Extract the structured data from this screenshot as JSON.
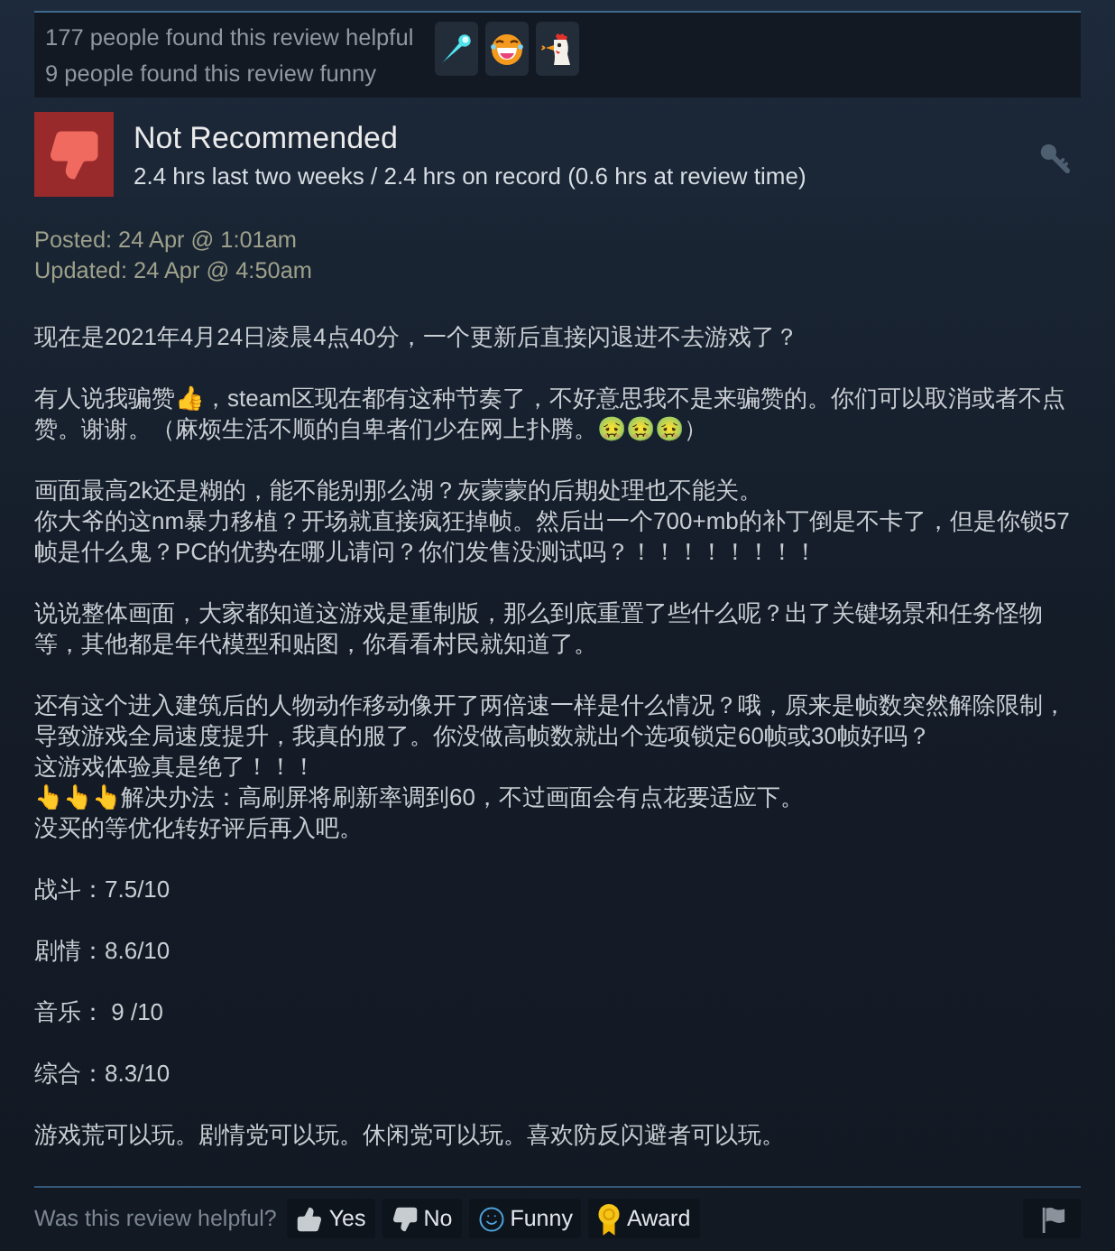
{
  "awards_summary": {
    "helpful_text": "177 people found this review helpful",
    "funny_text": "9 people found this review funny",
    "awards": [
      {
        "kind": "comet"
      },
      {
        "kind": "laughing-face"
      },
      {
        "kind": "rooster"
      }
    ]
  },
  "review_header": {
    "recommended": false,
    "verdict": "Not Recommended",
    "hours": "2.4 hrs last two weeks / 2.4 hrs on record (0.6 hrs at review time)"
  },
  "dates": {
    "posted": "Posted: 24 Apr @ 1:01am",
    "updated": "Updated: 24 Apr @ 4:50am"
  },
  "paragraphs": [
    {
      "lines": [
        "现在是2021年4月24日凌晨4点40分，一个更新后直接闪退进不去游戏了？"
      ]
    },
    {
      "lines": [
        "有人说我骗赞👍，steam区现在都有这种节奏了，不好意思我不是来骗赞的。你们可以取消或者不点赞。谢谢。（麻烦生活不顺的自卑者们少在网上扑腾。🤢🤢🤢）"
      ]
    },
    {
      "lines": [
        "画面最高2k还是糊的，能不能别那么湖？灰蒙蒙的后期处理也不能关。",
        "你大爷的这nm暴力移植？开场就直接疯狂掉帧。然后出一个700+mb的补丁倒是不卡了，但是你锁57帧是什么鬼？PC的优势在哪儿请问？你们发售没测试吗？！！！！！！！！"
      ]
    },
    {
      "lines": [
        "说说整体画面，大家都知道这游戏是重制版，那么到底重置了些什么呢？出了关键场景和任务怪物等，其他都是年代模型和贴图，你看看村民就知道了。"
      ]
    },
    {
      "lines": [
        "还有这个进入建筑后的人物动作移动像开了两倍速一样是什么情况？哦，原来是帧数突然解除限制，导致游戏全局速度提升，我真的服了。你没做高帧数就出个选项锁定60帧或30帧好吗？",
        "这游戏体验真是绝了！！！",
        "👆👆👆解决办法：高刷屏将刷新率调到60，不过画面会有点花要适应下。",
        "没买的等优化转好评后再入吧。"
      ]
    },
    {
      "lines": [
        "战斗：7.5/10"
      ]
    },
    {
      "lines": [
        "剧情：8.6/10"
      ]
    },
    {
      "lines": [
        "音乐： 9 /10"
      ]
    },
    {
      "lines": [
        "综合：8.3/10"
      ]
    },
    {
      "lines": [
        "游戏荒可以玩。剧情党可以玩。休闲党可以玩。喜欢防反闪避者可以玩。"
      ]
    }
  ],
  "footer": {
    "prompt": "Was this review helpful?",
    "buttons": [
      {
        "kind": "yes",
        "label": "Yes"
      },
      {
        "kind": "no",
        "label": "No"
      },
      {
        "kind": "funny",
        "label": "Funny"
      },
      {
        "kind": "award",
        "label": "Award"
      },
      {
        "kind": "report"
      }
    ]
  }
}
